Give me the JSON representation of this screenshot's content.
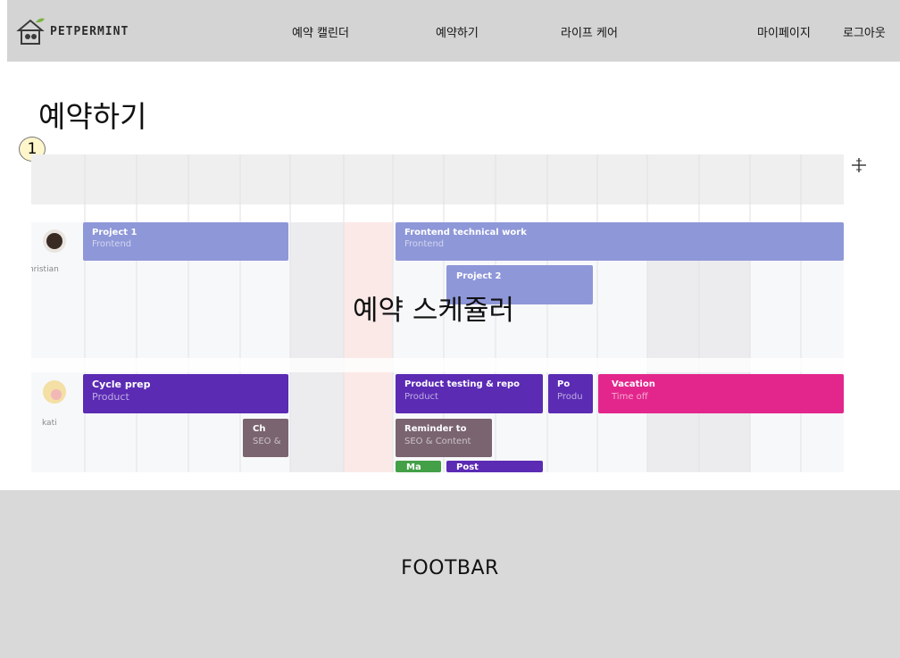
{
  "header": {
    "logo_text": "PETPERMINT",
    "nav": [
      "예약 캘린더",
      "예약하기",
      "라이프 케어",
      "마이페이지",
      "로그아웃"
    ]
  },
  "page": {
    "title": "예약하기",
    "step_number": "1"
  },
  "scheduler": {
    "label": "예약 스케쥴러",
    "people": [
      "christian",
      "kati"
    ],
    "events": [
      {
        "title": "Project 1",
        "subtitle": "Frontend",
        "color": "#8e97d8"
      },
      {
        "title": "Frontend technical work",
        "subtitle": "Frontend",
        "color": "#8e97d8"
      },
      {
        "title": "Project 2",
        "subtitle": "",
        "color": "#8e97d8"
      },
      {
        "title": "Cycle prep",
        "subtitle": "Product",
        "color": "#5b2bb4"
      },
      {
        "title": "Product testing & repo",
        "subtitle": "Product",
        "color": "#5b2bb4"
      },
      {
        "title": "Po",
        "subtitle": "Produ",
        "color": "#5b2bb4"
      },
      {
        "title": "Vacation",
        "subtitle": "Time off",
        "color": "#e3268c"
      },
      {
        "title": "Ch",
        "subtitle": "SEO &",
        "color": "#7a6470"
      },
      {
        "title": "Reminder to",
        "subtitle": "SEO & Content",
        "color": "#7a6470"
      },
      {
        "title": "Ma",
        "subtitle": "",
        "color": "#43a047"
      },
      {
        "title": "Post",
        "subtitle": "",
        "color": "#5b2bb4"
      }
    ]
  },
  "footer": {
    "label": "FOOTBAR"
  }
}
